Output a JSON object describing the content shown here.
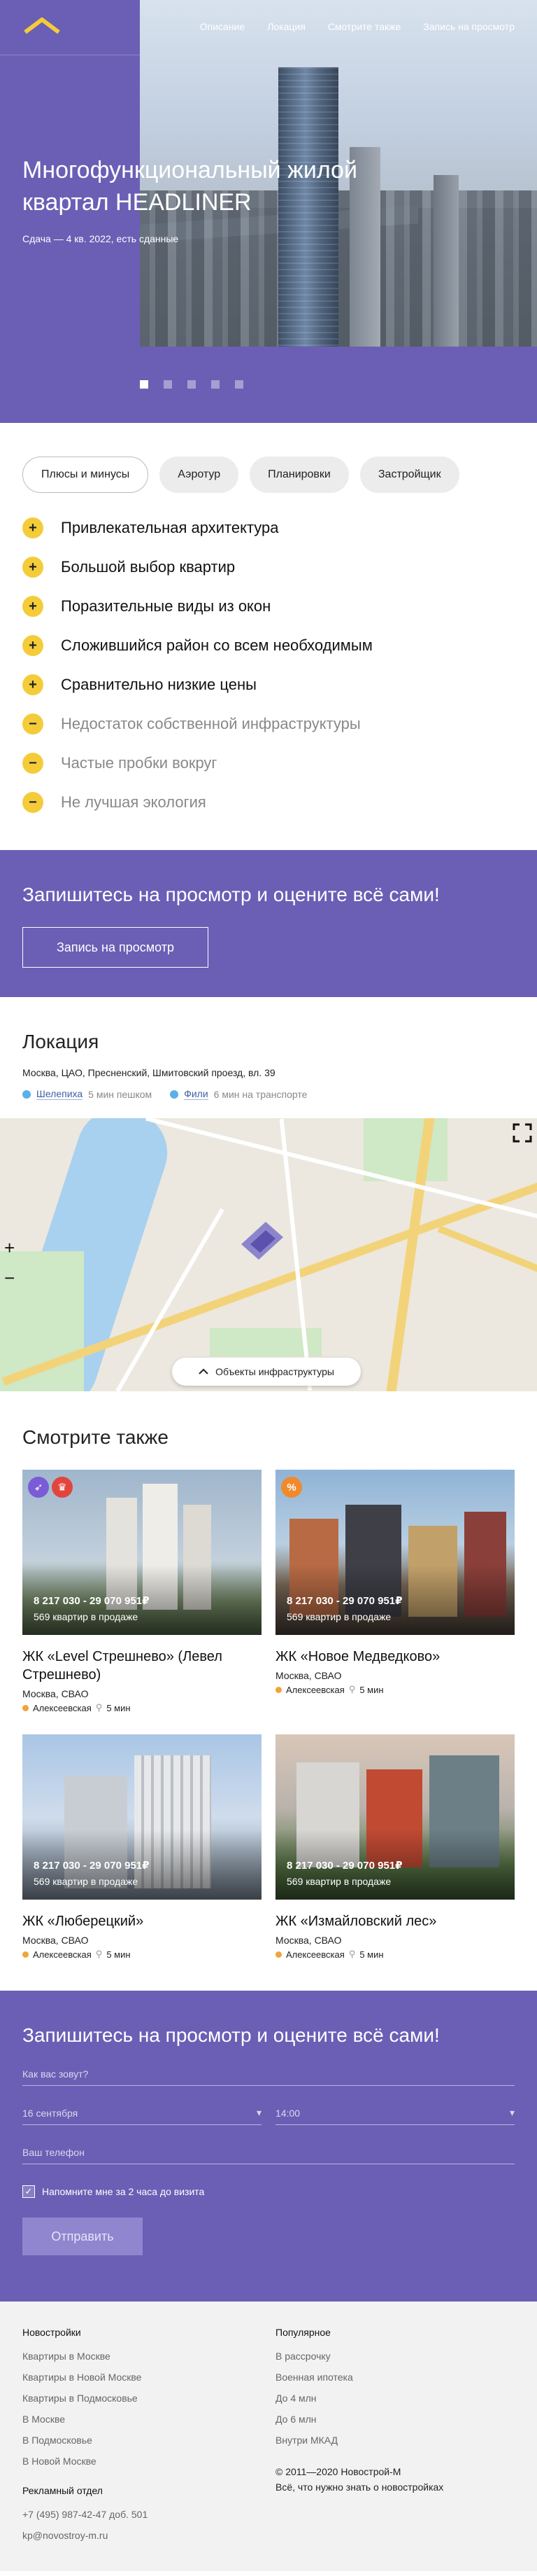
{
  "nav": {
    "items": [
      "Описание",
      "Локация",
      "Смотрите также",
      "Запись на просмотр"
    ]
  },
  "hero": {
    "title": "Многофункциональный жилой квартал HEADLINER",
    "subtitle": "Сдача — 4 кв. 2022, есть сданные",
    "slides": 5,
    "active_slide": 1
  },
  "features": {
    "tabs": [
      "Плюсы и минусы",
      "Аэротур",
      "Планировки",
      "Застройщик"
    ],
    "active_tab": 0,
    "items": [
      {
        "type": "plus",
        "icon": "plus-icon",
        "text": "Привлекательная архитектура"
      },
      {
        "type": "plus",
        "icon": "plus-icon",
        "text": "Большой выбор квартир"
      },
      {
        "type": "plus",
        "icon": "plus-icon",
        "text": "Поразительные виды из окон"
      },
      {
        "type": "plus",
        "icon": "plus-icon",
        "text": "Сложившийся район со всем необходимым"
      },
      {
        "type": "plus",
        "icon": "plus-icon",
        "text": "Сравнительно низкие цены"
      },
      {
        "type": "minus",
        "icon": "minus-icon",
        "text": "Недостаток собственной инфраструктуры"
      },
      {
        "type": "minus",
        "icon": "minus-icon",
        "text": "Частые пробки вокруг"
      },
      {
        "type": "minus",
        "icon": "minus-icon",
        "text": "Не лучшая экология"
      }
    ]
  },
  "cta": {
    "title": "Запишитесь на просмотр и оцените всё сами!",
    "button": "Запись на просмотр"
  },
  "location": {
    "title": "Локация",
    "address": "Москва, ЦАО, Пресненский, Шмитовский проезд, вл. 39",
    "metros": [
      {
        "name": "Шелепиха",
        "time": "5 мин пешком"
      },
      {
        "name": "Фили",
        "time": "6 мин на транспорте"
      }
    ],
    "map_infra_button": "Объекты инфраструктуры",
    "map_zoom_in": "+",
    "map_zoom_out": "−"
  },
  "seealso": {
    "title": "Смотрите также",
    "cards": [
      {
        "price": "8 217 030 - 29 070 951₽",
        "count": "569 квартир в продаже",
        "name": "ЖК «Level Стрешнево» (Левел Стрешнево)",
        "district": "Москва, СВАО",
        "metro": "Алексеевская",
        "walk": "5 мин",
        "badges": [
          "rocket-icon",
          "gift-icon"
        ]
      },
      {
        "price": "8 217 030 - 29 070 951₽",
        "count": "569 квартир в продаже",
        "name": "ЖК «Новое Медведково»",
        "district": "Москва, СВАО",
        "metro": "Алексеевская",
        "walk": "5 мин",
        "badges": [
          "percent-icon"
        ]
      },
      {
        "price": "8 217 030 - 29 070 951₽",
        "count": "569 квартир в продаже",
        "name": "ЖК «Люберецкий»",
        "district": "Москва, СВАО",
        "metro": "Алексеевская",
        "walk": "5 мин",
        "badges": []
      },
      {
        "price": "8 217 030 - 29 070 951₽",
        "count": "569 квартир в продаже",
        "name": "ЖК «Измайловский лес»",
        "district": "Москва, СВАО",
        "metro": "Алексеевская",
        "walk": "5 мин",
        "badges": []
      }
    ]
  },
  "form": {
    "title": "Запишитесь на просмотр и оцените всё сами!",
    "name_placeholder": "Как вас зовут?",
    "date_value": "16 сентября",
    "time_value": "14:00",
    "phone_placeholder": "Ваш телефон",
    "remind_label": "Напомните мне за 2 часа до визита",
    "remind_checked": true,
    "submit": "Отправить"
  },
  "footer": {
    "col1_title": "Новостройки",
    "col1_links": [
      "Квартиры в Москве",
      "Квартиры в Новой Москве",
      "Квартиры в Подмосковье",
      "В Москве",
      "В Подмосковье",
      "В Новой Москве"
    ],
    "col2_title": "Популярное",
    "col2_links": [
      "В рассрочку",
      "Военная ипотека",
      "До 4 млн",
      "До 6 млн",
      "Внутри МКАД"
    ],
    "ad_title": "Рекламный отдел",
    "ad_phone": "+7 (495) 987-42-47 доб. 501",
    "ad_email": "kp@novostroy-m.ru",
    "copyright": "© 2011—2020 Новострой-М",
    "tagline": "Всё, что нужно знать о новостройках"
  },
  "colors": {
    "brand_purple": "#6a5fb5",
    "accent_yellow": "#f4cc3a",
    "metro_blue": "#5ab0e8",
    "metro_orange": "#f2a33a"
  }
}
